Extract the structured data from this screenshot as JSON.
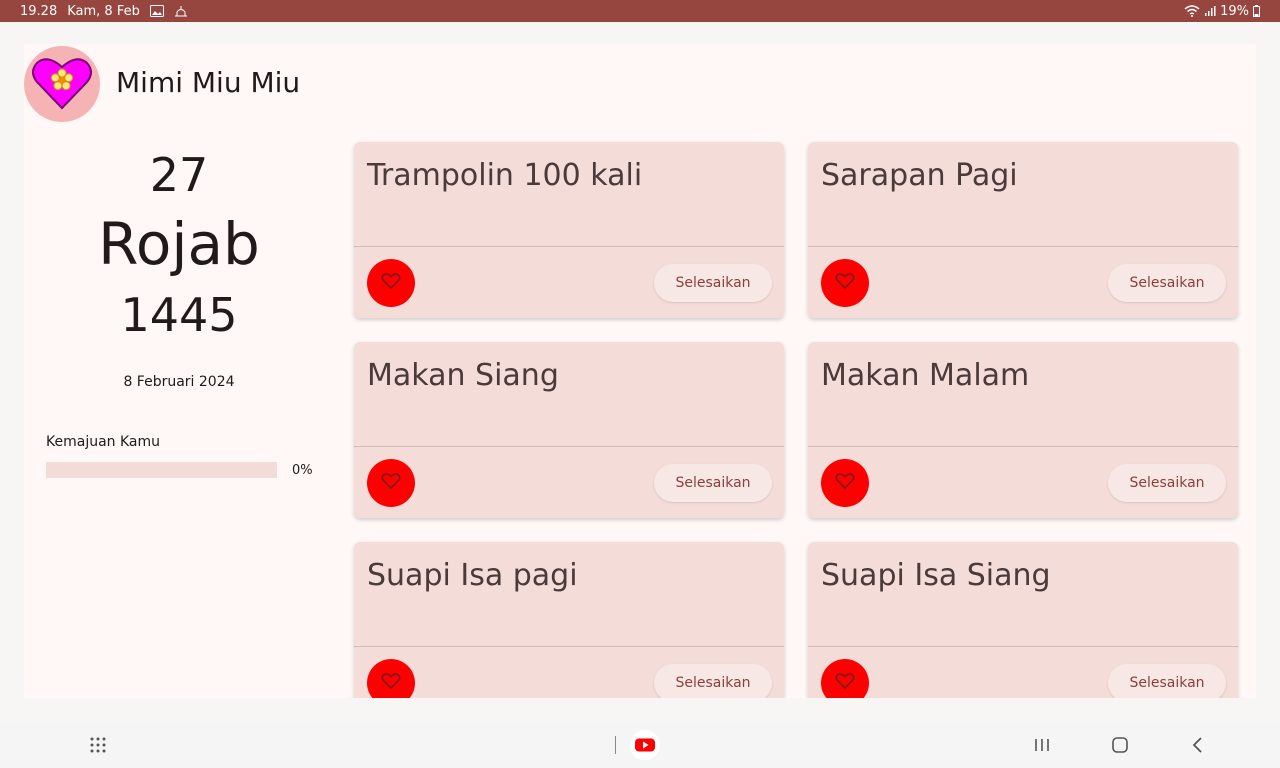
{
  "status_bar": {
    "time": "19.28",
    "date": "Kam, 8 Feb",
    "battery": "19%",
    "icons": [
      "gallery-icon",
      "mosque-icon",
      "wifi-icon",
      "signal-icon",
      "battery-icon"
    ]
  },
  "app": {
    "title": "Mimi Miu Miu",
    "avatar_icon": "heart-flower-icon",
    "colors": {
      "status_bar": "#96463f",
      "card_bg": "#f4ddd9",
      "fav_button": "#ff0000",
      "button_text": "#8b3f39"
    }
  },
  "hijri_date": {
    "day": "27",
    "month": "Rojab",
    "year": "1445"
  },
  "gregorian_date": "8 Februari 2024",
  "progress": {
    "label": "Kemajuan Kamu",
    "percent_text": "0%",
    "value": 0
  },
  "tasks": [
    {
      "title": "Trampolin 100 kali",
      "button": "Selesaikan",
      "fav_icon": "heart-outline-icon"
    },
    {
      "title": "Sarapan Pagi",
      "button": "Selesaikan",
      "fav_icon": "heart-outline-icon"
    },
    {
      "title": "Makan Siang",
      "button": "Selesaikan",
      "fav_icon": "heart-outline-icon"
    },
    {
      "title": "Makan Malam",
      "button": "Selesaikan",
      "fav_icon": "heart-outline-icon"
    },
    {
      "title": "Suapi Isa pagi",
      "button": "Selesaikan",
      "fav_icon": "heart-outline-icon"
    },
    {
      "title": "Suapi Isa Siang",
      "button": "Selesaikan",
      "fav_icon": "heart-outline-icon"
    }
  ],
  "nav_bar": {
    "icons": [
      "app-drawer-icon",
      "youtube-icon",
      "recents-icon",
      "home-icon",
      "back-icon"
    ]
  }
}
